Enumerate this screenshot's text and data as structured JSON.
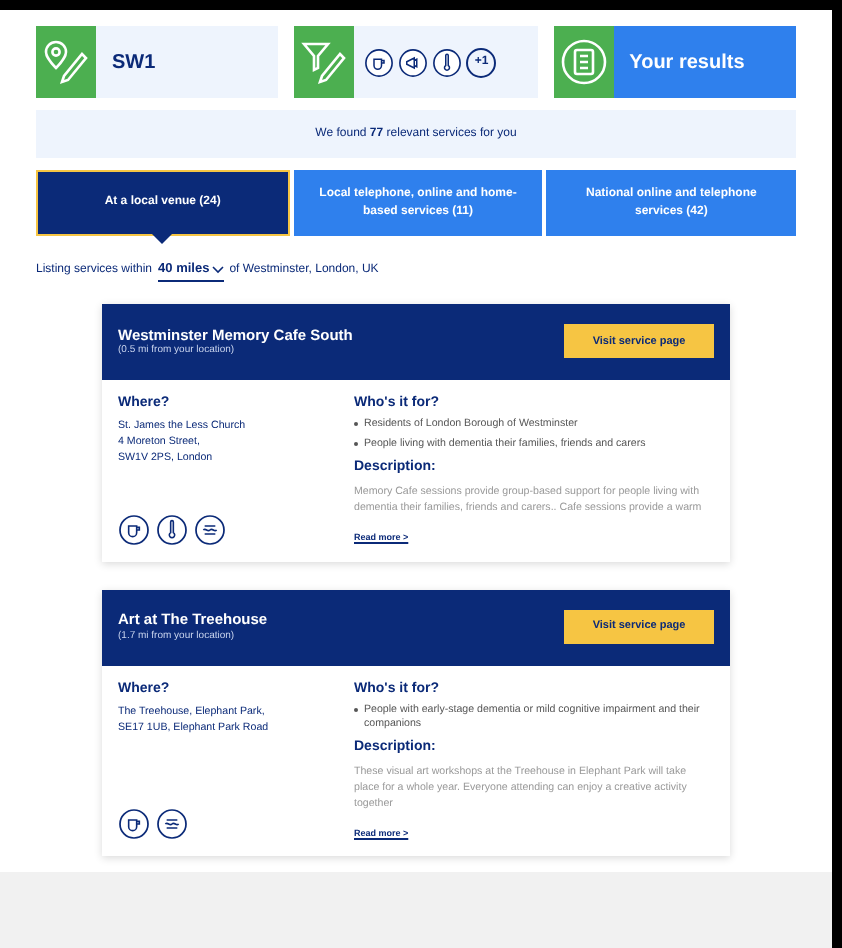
{
  "search_steps": [
    {
      "kind": "location",
      "text": "SW1"
    },
    {
      "kind": "filters",
      "extra": "+1"
    },
    {
      "kind": "results",
      "text": "Your results"
    }
  ],
  "banner": "We found **77** relevant services for you",
  "tabs": [
    {
      "label": "At a local venue (24)",
      "selected": true
    },
    {
      "label": "Local telephone, online and home-based services (11)",
      "selected": false
    },
    {
      "label": "National online and telephone services (42)",
      "selected": false
    }
  ],
  "listing": {
    "prefix": "Listing services within",
    "distance": "40 miles",
    "suffix": "of Westminster, London, UK"
  },
  "services": [
    {
      "title": "Westminster Memory Cafe South",
      "distance": "(0.5 mi from your location)",
      "button": "Visit service page",
      "where_heading": "Where?",
      "address": [
        "St. James the Less Church",
        "4 Moreton Street,",
        "SW1V 2PS, London"
      ],
      "icons": [
        {
          "kind": "cup"
        },
        {
          "kind": "thermometer"
        },
        {
          "kind": "age"
        }
      ],
      "who_heading": "Who's it for?",
      "who": [
        "Residents of London Borough of Westminster",
        "People living with dementia their families, friends and carers"
      ],
      "description_heading": "Description:",
      "description": "Memory Cafe sessions provide group-based support for people living with dementia their families, friends and carers.. Cafe sessions provide a warm",
      "read_more": "Read more >"
    },
    {
      "title": "Art at The Treehouse",
      "distance": "(1.7 mi from your location)",
      "button": "Visit service page",
      "where_heading": "Where?",
      "address": [
        "The Treehouse, Elephant Park,",
        "SE17 1UB, Elephant Park Road"
      ],
      "icons": [
        {
          "kind": "cup"
        },
        {
          "kind": "age"
        }
      ],
      "who_heading": "Who's it for?",
      "who": [
        "People with early-stage dementia or mild cognitive impairment and their companions"
      ],
      "description_heading": "Description:",
      "description": "These visual art workshops at the Treehouse in Elephant Park will take place for a whole year. Everyone attending can enjoy a creative activity together",
      "read_more": "Read more >"
    }
  ]
}
